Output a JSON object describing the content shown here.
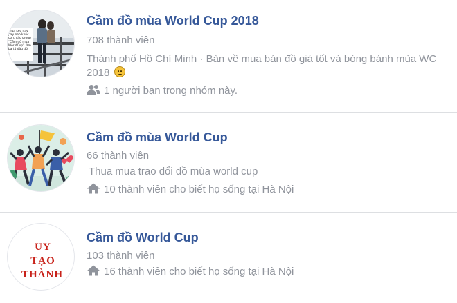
{
  "groups": [
    {
      "name": "Cầm đồ mùa World Cup 2018",
      "members": "708 thành viên",
      "description": "Thành phố Hồ Chí Minh · Bàn về mua bán đồ giá tốt và bóng bánh mùa WC 2018",
      "meta": "1 người bạn trong nhóm này.",
      "meta_icon": "friends-icon",
      "avatar_text": "thua kèo này pay neo khúc con, vào group \"Cầm đồ mùa WorldCup\" làm bạ tứ đâu đó"
    },
    {
      "name": "Cầm đồ mùa World Cup",
      "members": "66 thành viên",
      "description": "Thua mua trao đổi đồ mùa world cup",
      "meta": "10 thành viên cho biết họ sống tại Hà Nội",
      "meta_icon": "home-icon"
    },
    {
      "name": "Cầm đồ World Cup",
      "members": "103 thành viên",
      "meta": "16 thành viên cho biết họ sống tại Hà Nội",
      "meta_icon": "home-icon",
      "avatar_text_lines": [
        "UY",
        "TẠO",
        "THÀNH"
      ]
    }
  ],
  "colors": {
    "link": "#365899",
    "secondary_text": "#90949c",
    "divider": "#dddfe2",
    "avatar_red_text": "#c8221a"
  }
}
